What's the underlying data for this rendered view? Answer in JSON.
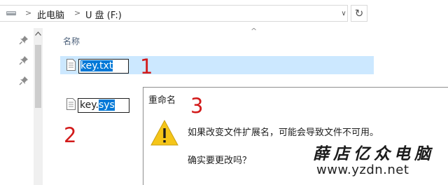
{
  "address_bar": {
    "crumbs": [
      "此电脑",
      "U 盘 (F:)"
    ],
    "separator": ">",
    "dropdown_icon": "chevron-down-icon",
    "refresh_icon": "refresh-icon",
    "refresh_glyph": "↻",
    "dropdown_glyph": "∨"
  },
  "file_list": {
    "column_name": "名称",
    "sort_indicator": "^",
    "files": [
      {
        "name_selected": "key.txt",
        "name_unselected": "",
        "annotation": "1"
      },
      {
        "name_unselected": "key.",
        "name_selected": "sys",
        "annotation": "2"
      }
    ]
  },
  "dialog": {
    "title": "重命名",
    "annotation": "3",
    "icon": "warning-icon",
    "message": "如果改变文件扩展名，可能会导致文件不可用。",
    "question": "确实要更改吗？"
  },
  "watermark": {
    "brand_text": "薛店亿众电脑",
    "url": "www.yzdn.net"
  },
  "colors": {
    "selection": "#0078d7",
    "row_highlight": "#cce8ff",
    "annotation_red": "#d21a1a",
    "warning_yellow": "#f5c518"
  }
}
